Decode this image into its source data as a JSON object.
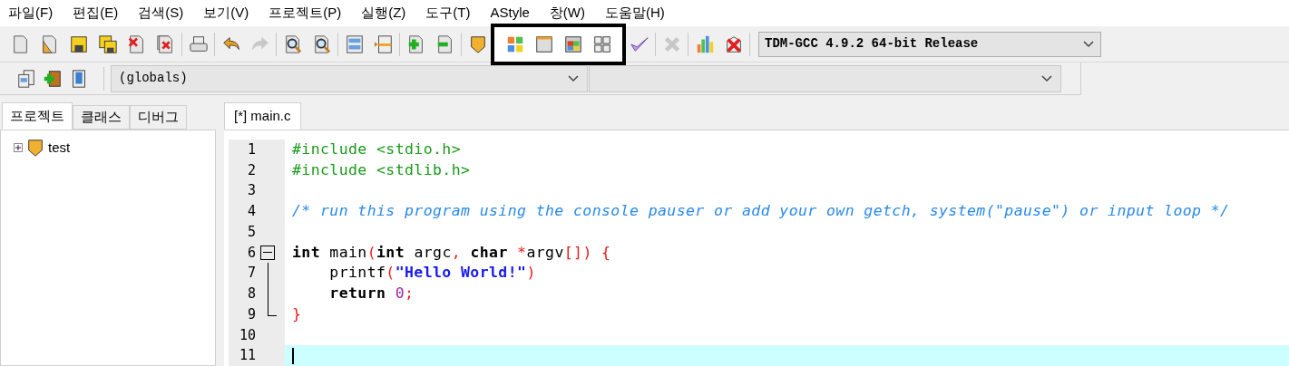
{
  "menu": [
    "파일(F)",
    "편집(E)",
    "검색(S)",
    "보기(V)",
    "프로젝트(P)",
    "실행(Z)",
    "도구(T)",
    "AStyle",
    "창(W)",
    "도움말(H)"
  ],
  "toolbar": {
    "groups": [
      {
        "highlighted": false,
        "buttons": [
          {
            "disabled": false
          },
          {
            "disabled": false
          },
          {
            "disabled": false
          },
          {
            "disabled": false
          },
          {
            "disabled": false
          },
          {
            "disabled": false
          }
        ]
      },
      {
        "highlighted": false,
        "buttons": [
          {
            "disabled": false
          }
        ]
      },
      {
        "highlighted": false,
        "buttons": [
          {
            "disabled": false
          },
          {
            "disabled": true
          }
        ]
      },
      {
        "highlighted": false,
        "buttons": [
          {
            "disabled": false
          },
          {
            "disabled": false
          }
        ]
      },
      {
        "highlighted": false,
        "buttons": [
          {
            "disabled": false
          },
          {
            "disabled": false
          }
        ]
      },
      {
        "highlighted": false,
        "buttons": [
          {
            "disabled": false
          },
          {
            "disabled": false
          }
        ]
      },
      {
        "highlighted": false,
        "buttons": [
          {
            "disabled": false
          }
        ]
      },
      {
        "highlighted": true,
        "buttons": [
          {
            "disabled": false
          },
          {
            "disabled": false
          },
          {
            "disabled": false
          },
          {
            "disabled": false
          }
        ]
      },
      {
        "highlighted": false,
        "buttons": [
          {
            "disabled": false
          }
        ]
      },
      {
        "highlighted": false,
        "buttons": [
          {
            "disabled": true
          }
        ]
      },
      {
        "highlighted": false,
        "buttons": [
          {
            "disabled": false
          },
          {
            "disabled": false
          }
        ]
      }
    ],
    "compiler": {
      "value": "TDM-GCC 4.9.2 64-bit Release"
    }
  },
  "toolbar2": {
    "buttons": [
      {
        "disabled": false
      },
      {
        "disabled": false
      },
      {
        "disabled": false
      }
    ],
    "scope": {
      "value": "(globals)"
    }
  },
  "panel_tabs": [
    {
      "label": "프로젝트",
      "selected": true
    },
    {
      "label": "클래스",
      "selected": false
    },
    {
      "label": "디버그",
      "selected": false
    }
  ],
  "project_tree": [
    {
      "label": "test",
      "expanded": false
    }
  ],
  "editor_tabs": [
    {
      "label": "[*] main.c",
      "selected": true
    }
  ],
  "lines": [
    {
      "number": "1",
      "current": false,
      "tokens": [
        {
          "kind": "preproc",
          "text": "#include <stdio.h>"
        }
      ]
    },
    {
      "number": "2",
      "current": false,
      "tokens": [
        {
          "kind": "preproc",
          "text": "#include <stdlib.h>"
        }
      ]
    },
    {
      "number": "3",
      "current": false
    },
    {
      "number": "4",
      "current": false,
      "tokens": [
        {
          "kind": "comment",
          "text": "/* run this program using the console pauser or add your own getch, system(\"pause\") or input loop */"
        }
      ]
    },
    {
      "number": "5",
      "current": false
    },
    {
      "number": "6",
      "current": false,
      "kind": "fold-start",
      "tokens": [
        {
          "kind": "keyword",
          "text": "int"
        },
        {
          "kind": "ident",
          "text": " main"
        },
        {
          "kind": "op",
          "text": "("
        },
        {
          "kind": "keyword",
          "text": "int"
        },
        {
          "kind": "ident",
          "text": " argc"
        },
        {
          "kind": "op",
          "text": ","
        },
        {
          "kind": "keyword",
          "text": " char"
        },
        {
          "kind": "op",
          "text": " *"
        },
        {
          "kind": "ident",
          "text": "argv"
        },
        {
          "kind": "op",
          "text": "[])"
        },
        {
          "kind": "op",
          "text": " {"
        }
      ]
    },
    {
      "number": "7",
      "current": false,
      "kind": "fold-body",
      "tokens": [
        {
          "kind": "ident",
          "text": "    printf"
        },
        {
          "kind": "op",
          "text": "("
        },
        {
          "kind": "string",
          "text": "\"Hello World!\""
        },
        {
          "kind": "op",
          "text": ")"
        }
      ]
    },
    {
      "number": "8",
      "current": false,
      "kind": "fold-body",
      "tokens": [
        {
          "kind": "keyword",
          "text": "    return"
        },
        {
          "kind": "number",
          "text": " 0"
        },
        {
          "kind": "op",
          "text": ";"
        }
      ]
    },
    {
      "number": "9",
      "current": false,
      "kind": "fold-end",
      "tokens": [
        {
          "kind": "op",
          "text": "}"
        }
      ]
    },
    {
      "number": "10",
      "current": false
    },
    {
      "number": "11",
      "current": true
    }
  ]
}
